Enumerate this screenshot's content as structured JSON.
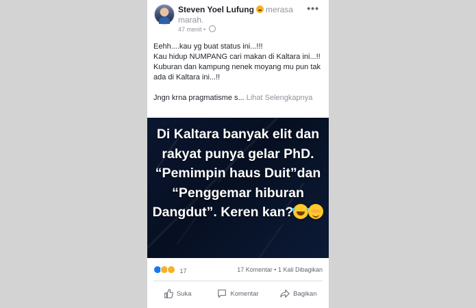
{
  "post": {
    "author": "Steven Yoel Lufung",
    "feeling_text": "merasa marah.",
    "timestamp": "47 menit",
    "separator": "•",
    "privacy_icon": "globe-icon",
    "more_icon": "more-options-icon",
    "text_lines": [
      "Eehh....kau yg buat status ini...!!!",
      "Kau hidup NUMPANG cari makan di Kaltara ini...!!",
      "Kuburan dan kampung nenek moyang mu pun tak ada di Kaltara ini...!!"
    ],
    "truncated_line": "Jngn krna pragmatisme s...",
    "see_more": "Lihat Selengkapnya",
    "image_text": "Di Kaltara banyak elit dan rakyat punya gelar PhD. “Pemimpin haus Duit”dan “Penggemar hiburan Dangdut”. Keren kan?",
    "image_emojis": [
      "laughing-crying-emoji-icon",
      "smiling-blush-emoji-icon"
    ]
  },
  "stats": {
    "reaction_icons": [
      "like-reaction-icon",
      "haha-reaction-icon",
      "sad-reaction-icon"
    ],
    "reaction_count": "17",
    "comments": "17 Komentar",
    "dot": "•",
    "shares": "1 Kali Dibagikan"
  },
  "actions": {
    "like": "Suka",
    "comment": "Komentar",
    "share": "Bagikan"
  },
  "colors": {
    "background": "#d3d3d3",
    "image_bg": "#0a1630",
    "like_blue": "#1877f2"
  }
}
